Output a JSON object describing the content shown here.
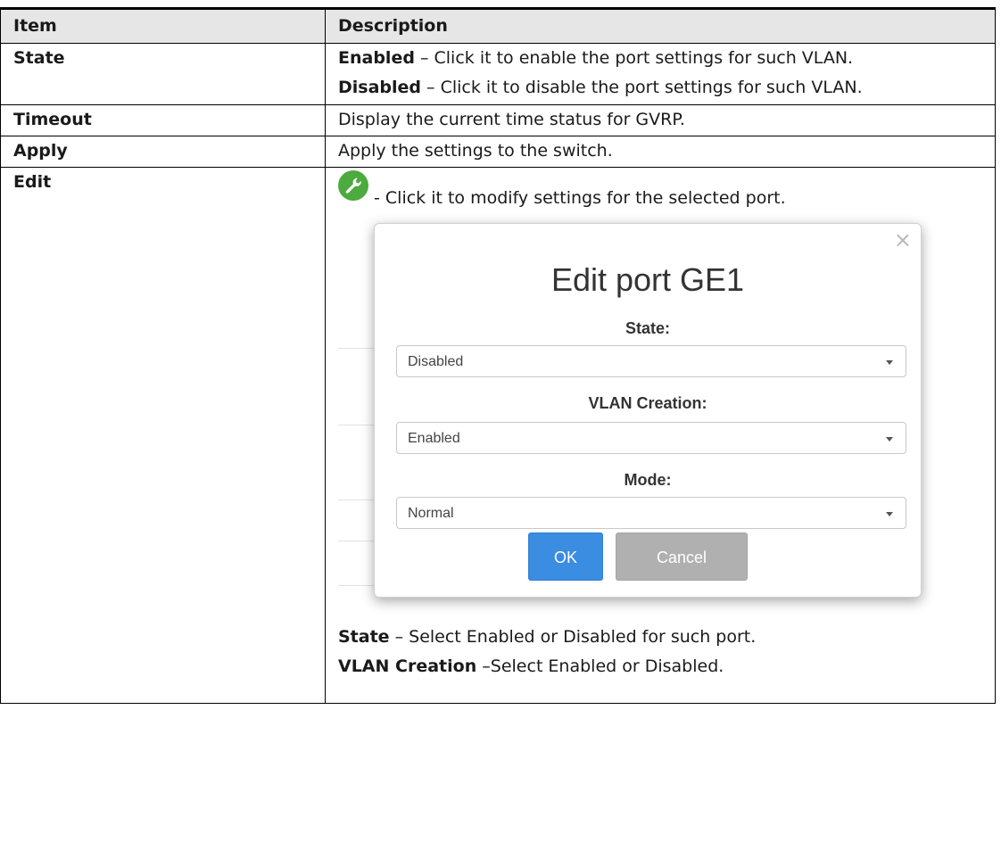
{
  "table": {
    "header": {
      "item": "Item",
      "description": "Description"
    },
    "rows": {
      "state": {
        "item": "State",
        "lines": [
          {
            "term": "Enabled",
            "text": " – Click it to enable the port settings for such VLAN."
          },
          {
            "term": "Disabled",
            "text": " – Click it to disable the port settings for such VLAN."
          }
        ]
      },
      "timeout": {
        "item": "Timeout",
        "text": "Display the current time status for GVRP."
      },
      "apply": {
        "item": "Apply",
        "text": "Apply the settings to the switch."
      },
      "edit": {
        "item": "Edit",
        "icon": "wrench-icon",
        "icon_color": "#4caa3f",
        "text": "- Click it to modify settings for the selected port.",
        "after_lines": [
          {
            "term": "State",
            "text": " – Select Enabled or Disabled for such port."
          },
          {
            "term": "VLAN Creation",
            "text": " –Select Enabled or Disabled."
          }
        ]
      }
    }
  },
  "modal": {
    "title": "Edit port GE1",
    "close_symbol": "×",
    "fields": {
      "state": {
        "label": "State:",
        "value": "Disabled"
      },
      "vlan_creation": {
        "label": "VLAN Creation:",
        "value": "Enabled"
      },
      "mode": {
        "label": "Mode:",
        "value": "Normal"
      }
    },
    "buttons": {
      "ok": "OK",
      "cancel": "Cancel"
    },
    "colors": {
      "ok": "#3a8de0",
      "cancel": "#b0b0b0"
    }
  }
}
